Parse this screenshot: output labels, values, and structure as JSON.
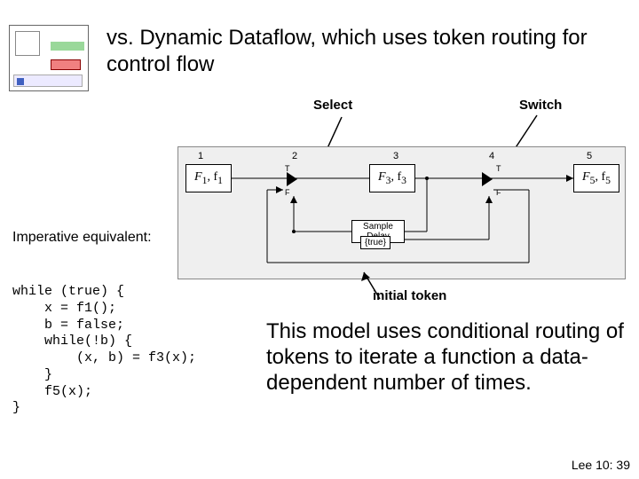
{
  "title": "vs. Dynamic Dataflow, which uses token routing for control flow",
  "labels": {
    "select": "Select",
    "switch": "Switch",
    "imperative": "Imperative equivalent:",
    "initial_token": "initial token"
  },
  "diagram": {
    "cols": [
      "1",
      "2",
      "3",
      "4",
      "5"
    ],
    "blocks": [
      {
        "fn": "F",
        "sub1": "1",
        "lower": "f",
        "sub2": "1"
      },
      {
        "fn": "F",
        "sub1": "3",
        "lower": "f",
        "sub2": "3"
      },
      {
        "fn": "F",
        "sub1": "5",
        "lower": "f",
        "sub2": "5"
      }
    ],
    "actor_t": "T",
    "actor_f": "F",
    "sample_delay": "Sample Delay",
    "init_token": "{true}"
  },
  "code": {
    "l1": "while (true) {",
    "l2": "    x = f1();",
    "l3": "    b = false;",
    "l4": "    while(!b) {",
    "l5": "        (x, b) = f3(x);",
    "l6": "    }",
    "l7": "    f5(x);",
    "l8": "}"
  },
  "explain": "This model uses conditional routing of tokens to iterate a function a data-dependent number of times.",
  "footer": "Lee 10: 39"
}
